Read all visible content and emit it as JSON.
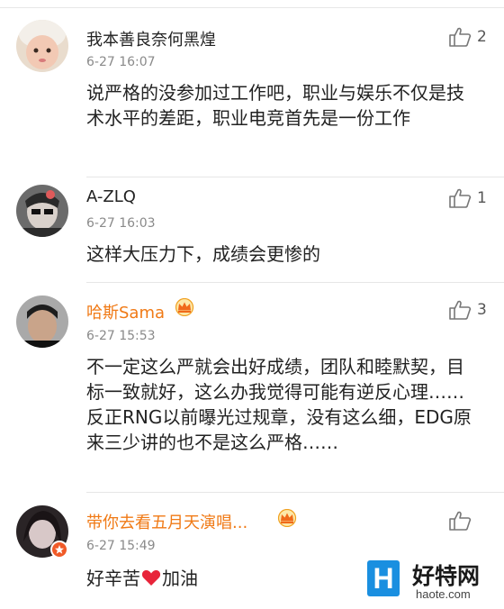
{
  "comments": [
    {
      "username": "我本善良奈何黑煌",
      "time": "6-27 16:07",
      "text": "说严格的没参加过工作吧，职业与娱乐不仅是技术水平的差距，职业电竞首先是一份工作",
      "likes": "2",
      "vip": false
    },
    {
      "username": "A-ZLQ",
      "time": "6-27 16:03",
      "text": "这样大压力下，成绩会更惨的",
      "likes": "1",
      "vip": false
    },
    {
      "username": "哈斯Sama",
      "time": "6-27 15:53",
      "text": "不一定这么严就会出好成绩，团队和睦默契，目标一致就好，这么办我觉得可能有逆反心理……反正RNG以前曝光过规章，没有这么细，EDG原来三少讲的也不是这么严格……",
      "likes": "3",
      "vip": true
    },
    {
      "username": "带你去看五月天演唱...",
      "time": "6-27 15:49",
      "text_before": "好辛苦",
      "text_after": "加油",
      "likes": "",
      "vip": true
    }
  ],
  "watermark": {
    "logo_letter": "H",
    "name": "好特网",
    "url": "haote.com"
  },
  "colors": {
    "vip_name": "#f07a16",
    "time": "#8a8a8a",
    "heart": "#e8243a",
    "watermark_blue": "#1a8fe0"
  }
}
